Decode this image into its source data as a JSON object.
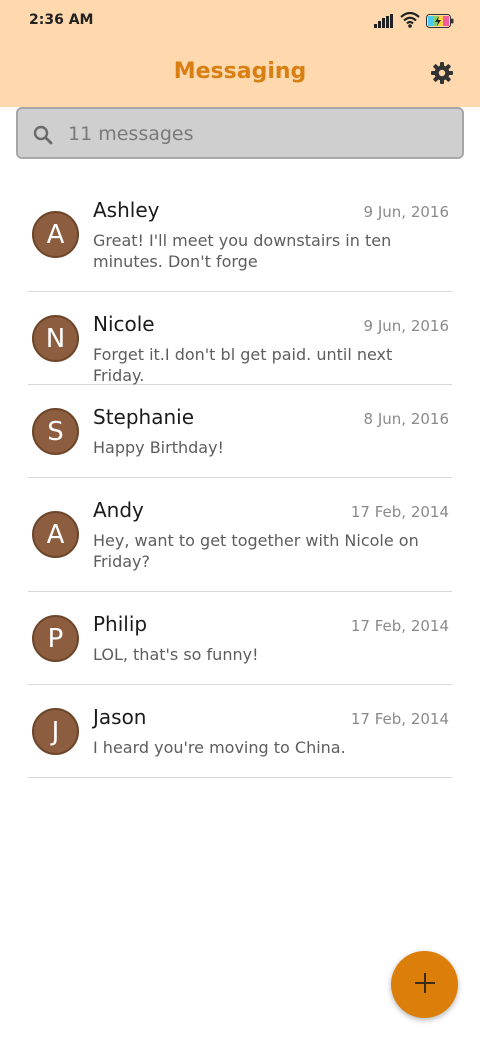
{
  "status_bar": {
    "time": "2:36 AM",
    "icons": [
      "signal-icon",
      "wifi-icon",
      "battery-icon"
    ]
  },
  "header": {
    "title": "Messaging",
    "settings_icon": "gear-icon"
  },
  "search": {
    "placeholder": "11 messages",
    "icon": "search-icon"
  },
  "conversations": [
    {
      "initial": "A",
      "name": "Ashley",
      "date": "9 Jun, 2016",
      "snippet": "Great! I'll meet you downstairs in ten minutes. Don't forge"
    },
    {
      "initial": "N",
      "name": "Nicole",
      "date": "9 Jun, 2016",
      "snippet": "Forget it.I don't bl get paid. until next Friday."
    },
    {
      "initial": "S",
      "name": "Stephanie",
      "date": "8 Jun, 2016",
      "snippet": "Happy Birthday!"
    },
    {
      "initial": "A",
      "name": "Andy",
      "date": "17 Feb, 2014",
      "snippet": "Hey, want to get together with Nicole on Friday?"
    },
    {
      "initial": "P",
      "name": "Philip",
      "date": "17 Feb, 2014",
      "snippet": "LOL, that's so funny!"
    },
    {
      "initial": "J",
      "name": "Jason",
      "date": "17 Feb, 2014",
      "snippet": "I heard you're moving to China."
    }
  ],
  "fab": {
    "icon": "plus-icon"
  },
  "colors": {
    "header_bg": "#ffd8ae",
    "title": "#d77f12",
    "avatar": "#8c5d3e",
    "fab": "#dc7e0a"
  }
}
